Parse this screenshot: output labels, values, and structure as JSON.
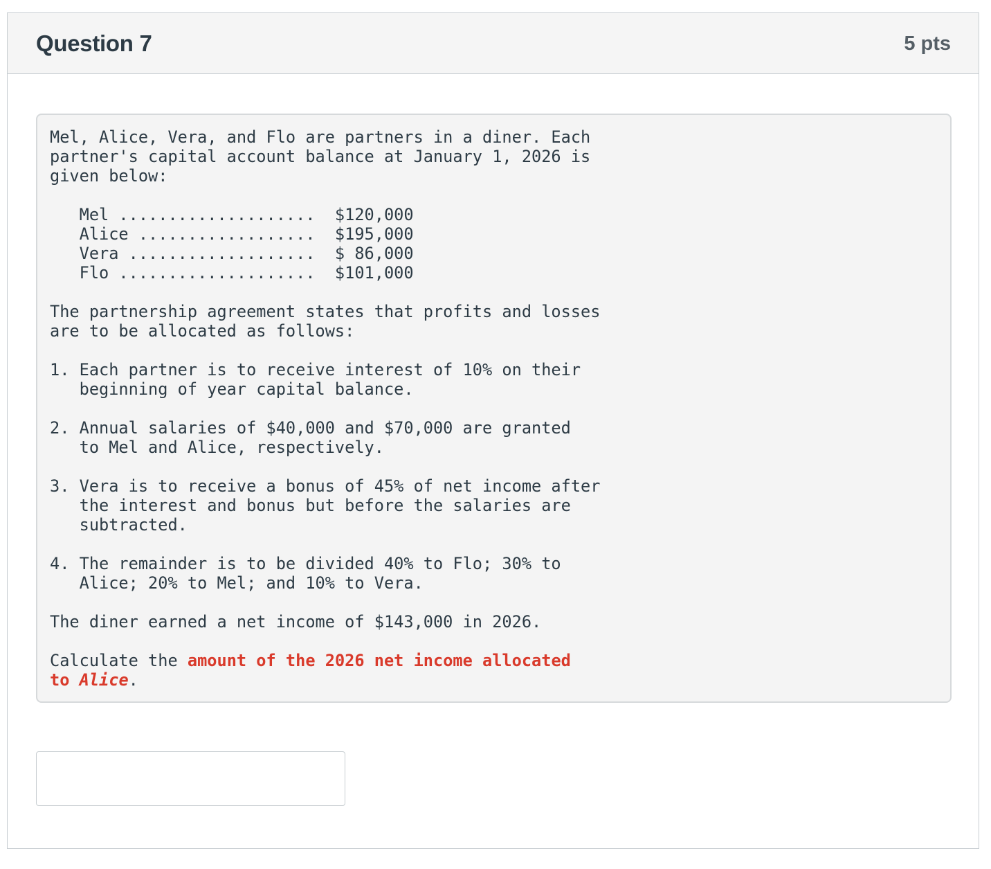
{
  "question": {
    "title": "Question 7",
    "points": "5 pts"
  },
  "problem": {
    "intro": "Mel, Alice, Vera, and Flo are partners in a diner. Each\npartner's capital account balance at January 1, 2026 is\ngiven below:",
    "balances": [
      {
        "line": "   Mel ....................  $120,000"
      },
      {
        "line": "   Alice ..................  $195,000"
      },
      {
        "line": "   Vera ...................  $ 86,000"
      },
      {
        "line": "   Flo ....................  $101,000"
      }
    ],
    "agreement": "The partnership agreement states that profits and losses\nare to be allocated as follows:",
    "rules": [
      {
        "text": "1. Each partner is to receive interest of 10% on their\n   beginning of year capital balance."
      },
      {
        "text": "2. Annual salaries of $40,000 and $70,000 are granted\n   to Mel and Alice, respectively."
      },
      {
        "text": "3. Vera is to receive a bonus of 45% of net income after\n   the interest and bonus but before the salaries are\n   subtracted."
      },
      {
        "text": "4. The remainder is to be divided 40% to Flo; 30% to\n   Alice; 20% to Mel; and 10% to Vera."
      }
    ],
    "net_income": "The diner earned a net income of $143,000 in 2026.",
    "prompt_prefix": "Calculate the ",
    "prompt_highlight_1": "amount of the 2026 net income allocated",
    "prompt_highlight_2": "to ",
    "prompt_highlight_name": "Alice",
    "prompt_suffix": "."
  },
  "answer": {
    "value": "",
    "placeholder": ""
  },
  "colors": {
    "highlight": "#d93a2b",
    "text": "#2d3b45",
    "header_bg": "#f5f5f5",
    "box_bg": "#f4f4f4"
  }
}
